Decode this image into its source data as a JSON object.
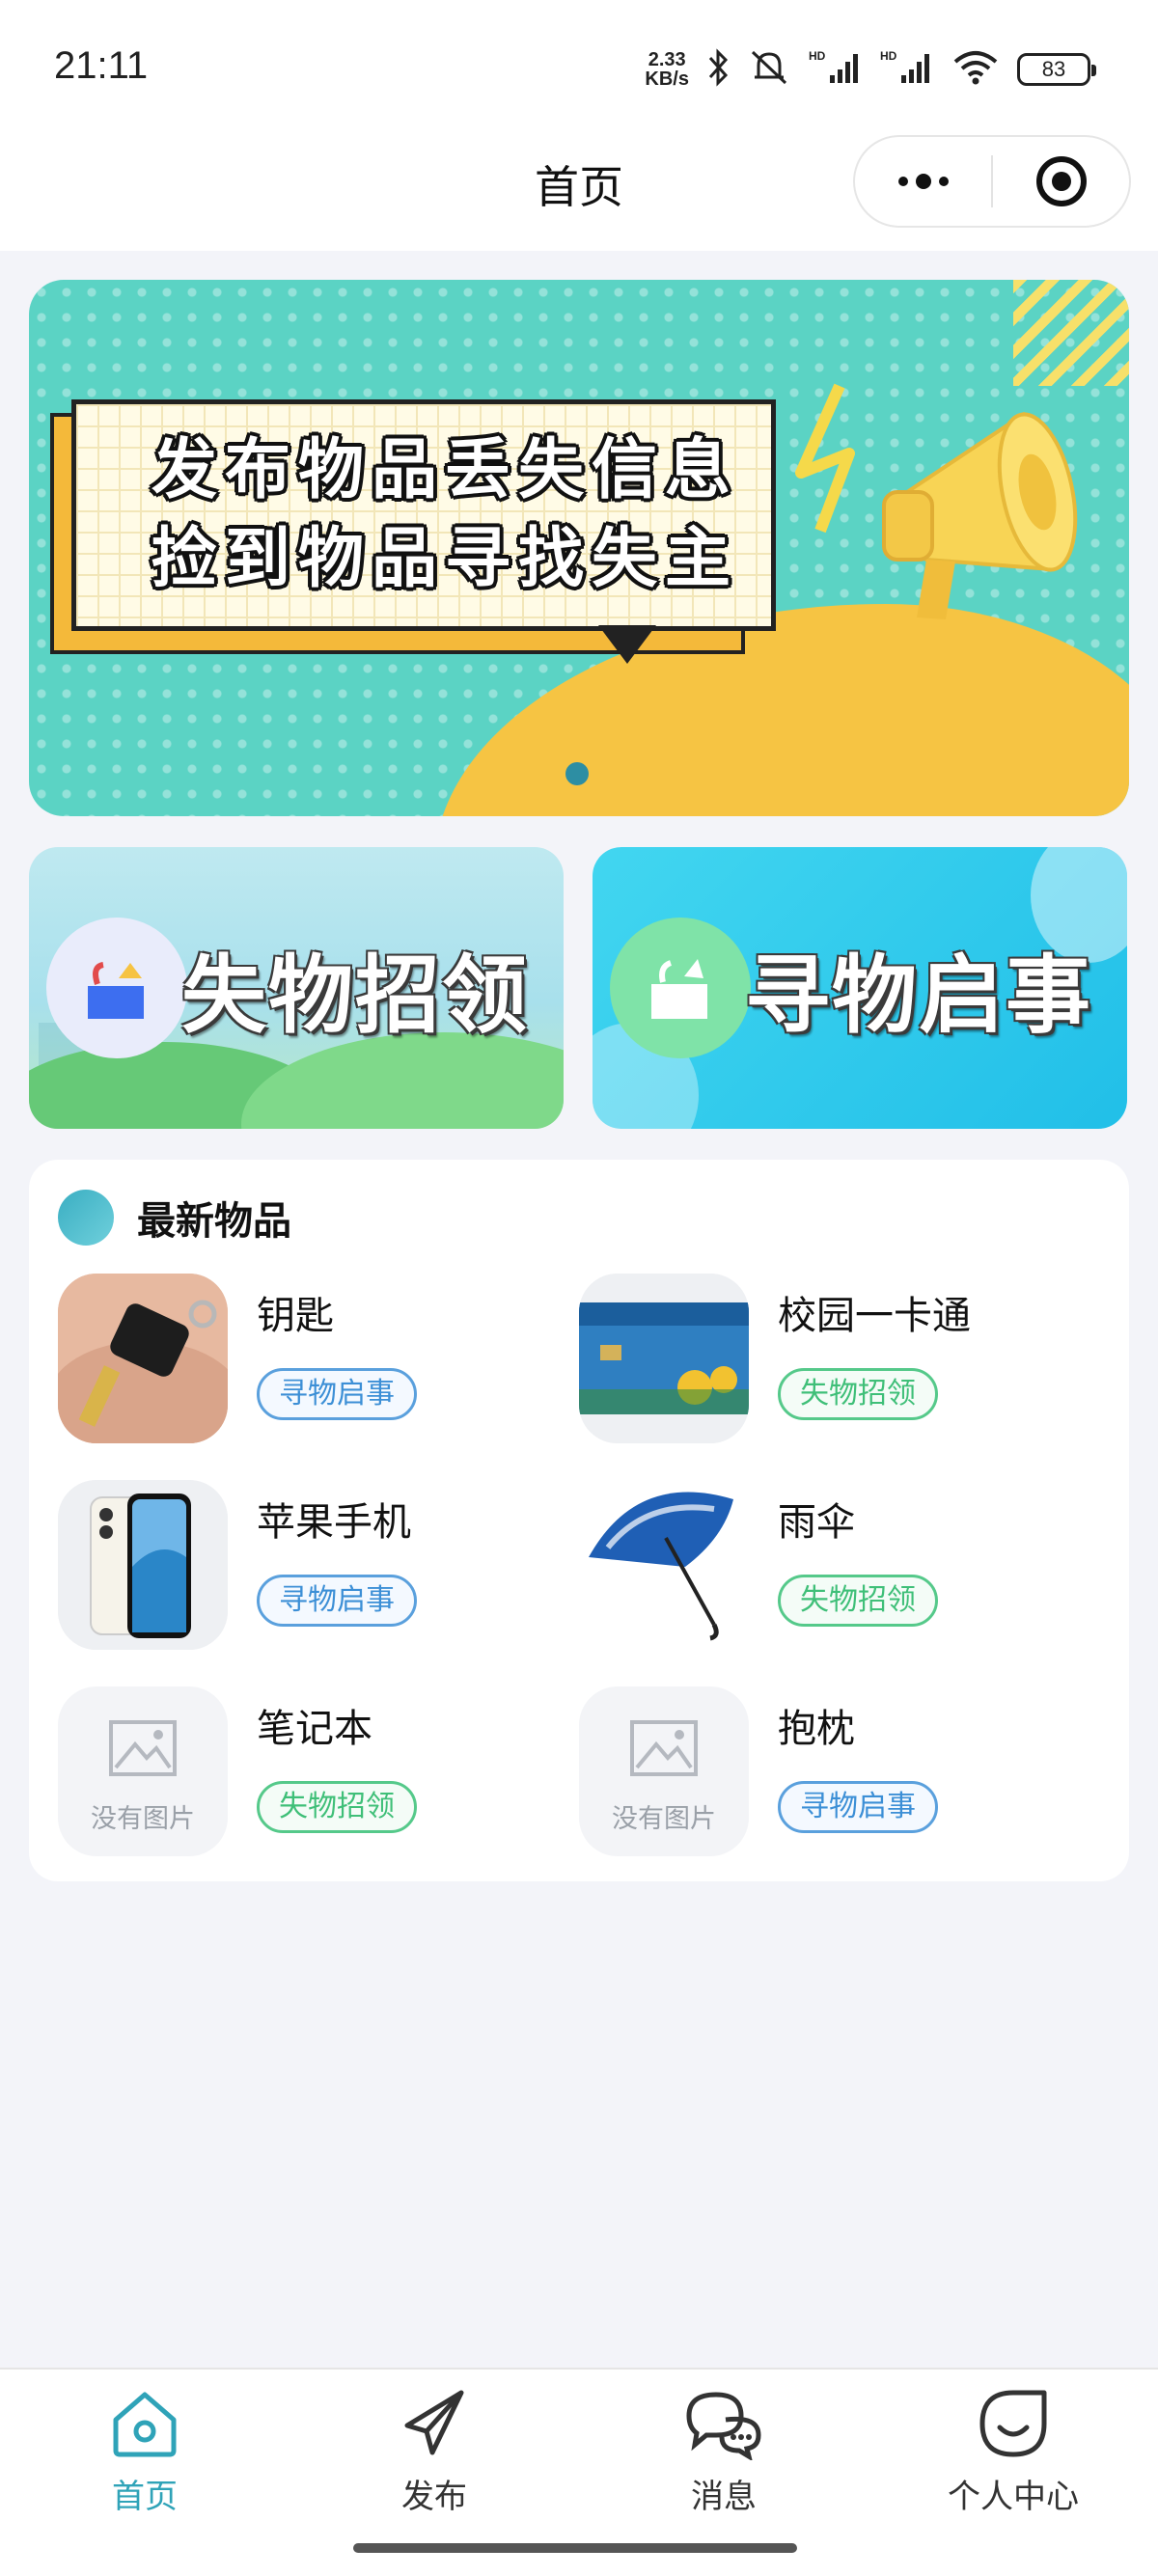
{
  "status_bar": {
    "time": "21:11",
    "net_speed_value": "2.33",
    "net_speed_unit": "KB/s",
    "battery": "83",
    "icons": [
      "bluetooth-icon",
      "mute-icon",
      "signal-hd-icon",
      "signal-hd-icon",
      "wifi-icon",
      "battery-icon"
    ]
  },
  "nav": {
    "title": "首页",
    "menu_icon": "more-dots-icon",
    "close_icon": "target-circle-icon"
  },
  "banner": {
    "line1": "发布物品丢失信息",
    "line2": "捡到物品寻找失主",
    "page_count": 1,
    "active_page": 1
  },
  "categories": [
    {
      "label": "失物招领",
      "icon": "open-box-icon"
    },
    {
      "label": "寻物启事",
      "icon": "box-search-icon"
    }
  ],
  "latest": {
    "title": "最新物品",
    "no_image_text": "没有图片",
    "items": [
      {
        "name": "钥匙",
        "tag": "寻物启事",
        "tag_color": "#3c8fd6",
        "thumb": "key-photo"
      },
      {
        "name": "校园一卡通",
        "tag": "失物招领",
        "tag_color": "#3fbf78",
        "thumb": "card-photo"
      },
      {
        "name": "苹果手机",
        "tag": "寻物启事",
        "tag_color": "#3c8fd6",
        "thumb": "phone-photo"
      },
      {
        "name": "雨伞",
        "tag": "失物招领",
        "tag_color": "#3fbf78",
        "thumb": "umbrella-photo"
      },
      {
        "name": "笔记本",
        "tag": "失物招领",
        "tag_color": "#3fbf78",
        "thumb": "no-image"
      },
      {
        "name": "抱枕",
        "tag": "寻物启事",
        "tag_color": "#3c8fd6",
        "thumb": "no-image"
      }
    ]
  },
  "tabs": [
    {
      "label": "首页",
      "icon": "home-icon",
      "active": true
    },
    {
      "label": "发布",
      "icon": "paper-plane-icon",
      "active": false
    },
    {
      "label": "消息",
      "icon": "chat-bubbles-icon",
      "active": false
    },
    {
      "label": "个人中心",
      "icon": "smile-face-icon",
      "active": false
    }
  ],
  "colors": {
    "accent": "#2fa3b8",
    "tag_blue": "#3c8fd6",
    "tag_green": "#3fbf78",
    "banner_bg": "#5bd3c4",
    "page_bg": "#f3f4f9"
  }
}
